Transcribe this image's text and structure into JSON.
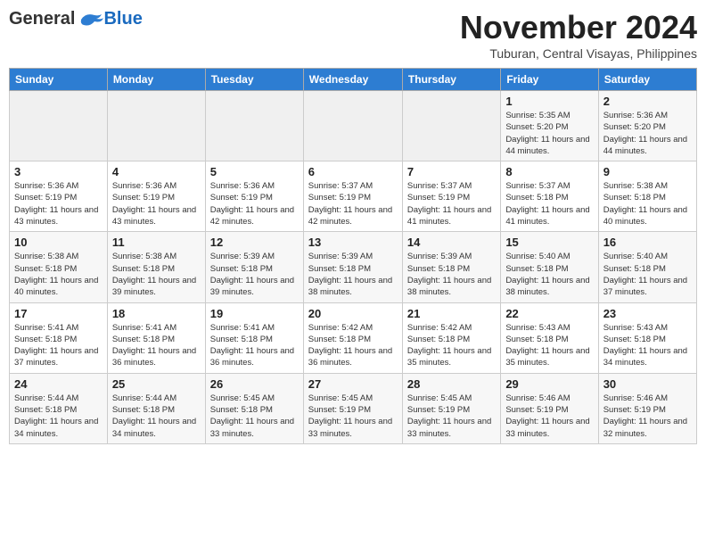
{
  "logo": {
    "general": "General",
    "blue": "Blue"
  },
  "title": "November 2024",
  "location": "Tuburan, Central Visayas, Philippines",
  "days_of_week": [
    "Sunday",
    "Monday",
    "Tuesday",
    "Wednesday",
    "Thursday",
    "Friday",
    "Saturday"
  ],
  "weeks": [
    [
      {
        "day": "",
        "info": ""
      },
      {
        "day": "",
        "info": ""
      },
      {
        "day": "",
        "info": ""
      },
      {
        "day": "",
        "info": ""
      },
      {
        "day": "",
        "info": ""
      },
      {
        "day": "1",
        "info": "Sunrise: 5:35 AM\nSunset: 5:20 PM\nDaylight: 11 hours and 44 minutes."
      },
      {
        "day": "2",
        "info": "Sunrise: 5:36 AM\nSunset: 5:20 PM\nDaylight: 11 hours and 44 minutes."
      }
    ],
    [
      {
        "day": "3",
        "info": "Sunrise: 5:36 AM\nSunset: 5:19 PM\nDaylight: 11 hours and 43 minutes."
      },
      {
        "day": "4",
        "info": "Sunrise: 5:36 AM\nSunset: 5:19 PM\nDaylight: 11 hours and 43 minutes."
      },
      {
        "day": "5",
        "info": "Sunrise: 5:36 AM\nSunset: 5:19 PM\nDaylight: 11 hours and 42 minutes."
      },
      {
        "day": "6",
        "info": "Sunrise: 5:37 AM\nSunset: 5:19 PM\nDaylight: 11 hours and 42 minutes."
      },
      {
        "day": "7",
        "info": "Sunrise: 5:37 AM\nSunset: 5:19 PM\nDaylight: 11 hours and 41 minutes."
      },
      {
        "day": "8",
        "info": "Sunrise: 5:37 AM\nSunset: 5:18 PM\nDaylight: 11 hours and 41 minutes."
      },
      {
        "day": "9",
        "info": "Sunrise: 5:38 AM\nSunset: 5:18 PM\nDaylight: 11 hours and 40 minutes."
      }
    ],
    [
      {
        "day": "10",
        "info": "Sunrise: 5:38 AM\nSunset: 5:18 PM\nDaylight: 11 hours and 40 minutes."
      },
      {
        "day": "11",
        "info": "Sunrise: 5:38 AM\nSunset: 5:18 PM\nDaylight: 11 hours and 39 minutes."
      },
      {
        "day": "12",
        "info": "Sunrise: 5:39 AM\nSunset: 5:18 PM\nDaylight: 11 hours and 39 minutes."
      },
      {
        "day": "13",
        "info": "Sunrise: 5:39 AM\nSunset: 5:18 PM\nDaylight: 11 hours and 38 minutes."
      },
      {
        "day": "14",
        "info": "Sunrise: 5:39 AM\nSunset: 5:18 PM\nDaylight: 11 hours and 38 minutes."
      },
      {
        "day": "15",
        "info": "Sunrise: 5:40 AM\nSunset: 5:18 PM\nDaylight: 11 hours and 38 minutes."
      },
      {
        "day": "16",
        "info": "Sunrise: 5:40 AM\nSunset: 5:18 PM\nDaylight: 11 hours and 37 minutes."
      }
    ],
    [
      {
        "day": "17",
        "info": "Sunrise: 5:41 AM\nSunset: 5:18 PM\nDaylight: 11 hours and 37 minutes."
      },
      {
        "day": "18",
        "info": "Sunrise: 5:41 AM\nSunset: 5:18 PM\nDaylight: 11 hours and 36 minutes."
      },
      {
        "day": "19",
        "info": "Sunrise: 5:41 AM\nSunset: 5:18 PM\nDaylight: 11 hours and 36 minutes."
      },
      {
        "day": "20",
        "info": "Sunrise: 5:42 AM\nSunset: 5:18 PM\nDaylight: 11 hours and 36 minutes."
      },
      {
        "day": "21",
        "info": "Sunrise: 5:42 AM\nSunset: 5:18 PM\nDaylight: 11 hours and 35 minutes."
      },
      {
        "day": "22",
        "info": "Sunrise: 5:43 AM\nSunset: 5:18 PM\nDaylight: 11 hours and 35 minutes."
      },
      {
        "day": "23",
        "info": "Sunrise: 5:43 AM\nSunset: 5:18 PM\nDaylight: 11 hours and 34 minutes."
      }
    ],
    [
      {
        "day": "24",
        "info": "Sunrise: 5:44 AM\nSunset: 5:18 PM\nDaylight: 11 hours and 34 minutes."
      },
      {
        "day": "25",
        "info": "Sunrise: 5:44 AM\nSunset: 5:18 PM\nDaylight: 11 hours and 34 minutes."
      },
      {
        "day": "26",
        "info": "Sunrise: 5:45 AM\nSunset: 5:18 PM\nDaylight: 11 hours and 33 minutes."
      },
      {
        "day": "27",
        "info": "Sunrise: 5:45 AM\nSunset: 5:19 PM\nDaylight: 11 hours and 33 minutes."
      },
      {
        "day": "28",
        "info": "Sunrise: 5:45 AM\nSunset: 5:19 PM\nDaylight: 11 hours and 33 minutes."
      },
      {
        "day": "29",
        "info": "Sunrise: 5:46 AM\nSunset: 5:19 PM\nDaylight: 11 hours and 33 minutes."
      },
      {
        "day": "30",
        "info": "Sunrise: 5:46 AM\nSunset: 5:19 PM\nDaylight: 11 hours and 32 minutes."
      }
    ]
  ]
}
